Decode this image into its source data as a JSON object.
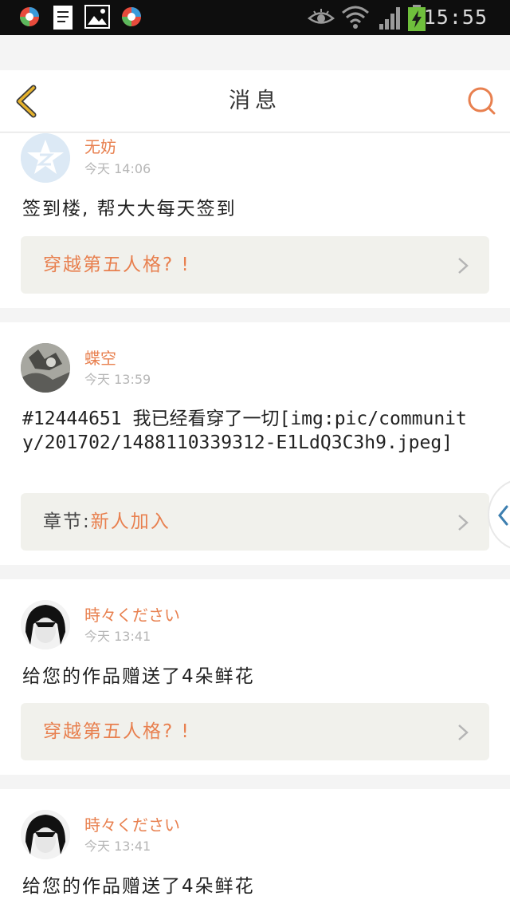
{
  "status_bar": {
    "time": "15:55",
    "left_icons": [
      "app-badge-icon",
      "document-icon",
      "image-icon",
      "app-badge-icon"
    ],
    "right_icons": [
      "eye-icon",
      "wifi-icon",
      "signal-icon",
      "battery-charging-icon"
    ]
  },
  "nav": {
    "title": "消息",
    "back_icon": "chevron-left-icon",
    "search_icon": "search-icon"
  },
  "colors": {
    "accent": "#e8804f",
    "back_icon": "#e6b22c",
    "ref_bg": "#f1f1ec"
  },
  "messages": [
    {
      "user": "无妨",
      "time": "今天 14:06",
      "text": "签到楼, 帮大大每天签到",
      "ref": {
        "label": "",
        "value": "穿越第五人格? !"
      }
    },
    {
      "user": "蝶空",
      "time": "今天 13:59",
      "text": "#12444651 我已经看穿了一切[img:pic/community/201702/1488110339312-E1LdQ3C3h9.jpeg]",
      "ref": {
        "label": "章节:",
        "value": "新人加入"
      }
    },
    {
      "user": "時々ください",
      "time": "今天 13:41",
      "text": "给您的作品赠送了4朵鲜花",
      "ref": {
        "label": "",
        "value": "穿越第五人格? !"
      }
    },
    {
      "user": "時々ください",
      "time": "今天 13:41",
      "text": "给您的作品赠送了4朵鲜花"
    }
  ]
}
